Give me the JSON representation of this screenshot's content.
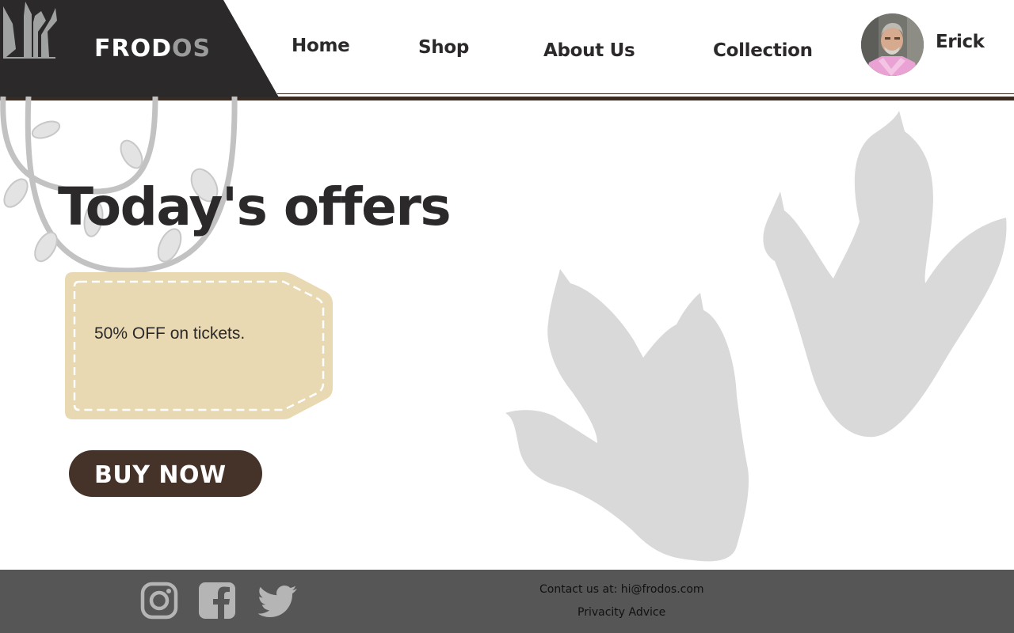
{
  "header": {
    "brand": {
      "primary": "FROD",
      "secondary": "OS"
    },
    "nav": {
      "home": "Home",
      "shop": "Shop",
      "about": "About Us",
      "collection": "Collection"
    },
    "user": {
      "name": "Erick"
    }
  },
  "main": {
    "title": "Today's offers",
    "offer_text": "50% OFF on tickets.",
    "cta_label": "BUY NOW"
  },
  "footer": {
    "contact": "Contact us at: hi@frodos.com",
    "privacy": "Privacity Advice",
    "social": [
      "instagram-icon",
      "facebook-icon",
      "twitter-icon"
    ]
  },
  "colors": {
    "brand_dark": "#2b2929",
    "accent_brown": "#45332a",
    "ticket": "#e8d9b2",
    "footer_bg": "#565656",
    "decor_gray": "#d9d9d9"
  }
}
